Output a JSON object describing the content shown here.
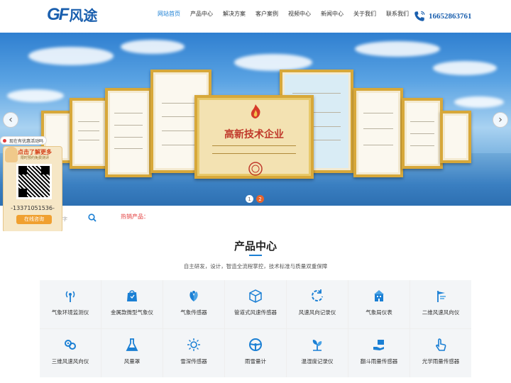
{
  "header": {
    "logo_mark": "GF",
    "logo_text": "风途",
    "phone": "16652863761",
    "nav": [
      "网站首页",
      "产品中心",
      "解决方案",
      "客户案例",
      "视频中心",
      "新闻中心",
      "关于我们",
      "联系我们"
    ],
    "active_nav": "网站首页"
  },
  "banner": {
    "cert_big_title": "高新技术企业",
    "slides": [
      "1",
      "2"
    ],
    "active_slide": "2"
  },
  "search": {
    "hint": "字",
    "hot_label": "热销产品："
  },
  "float": {
    "top_notice": "现在有优惠活动吗",
    "heading": "点击了解更多",
    "subheading": "限时预约免费测评",
    "phone": "-13371051536-",
    "button": "在线咨询"
  },
  "products": {
    "title": "产品中心",
    "subtitle": "自主研发，设计，智造全流程掌控，技术标准与质量双重保障",
    "items": [
      {
        "label": "气象环境监测仪",
        "icon": "antenna-icon"
      },
      {
        "label": "金属款微型气象仪",
        "icon": "shopping-bag-icon"
      },
      {
        "label": "气象传感器",
        "icon": "leaf-icon"
      },
      {
        "label": "管道式风速传感器",
        "icon": "box-icon"
      },
      {
        "label": "风速风向记录仪",
        "icon": "refresh-icon"
      },
      {
        "label": "气象局仪表",
        "icon": "building-icon"
      },
      {
        "label": "二维风速风向仪",
        "icon": "wind-vane-icon"
      },
      {
        "label": "三维风速风向仪",
        "icon": "chain-icon"
      },
      {
        "label": "风量罩",
        "icon": "flask-icon"
      },
      {
        "label": "雪深传感器",
        "icon": "sun-icon"
      },
      {
        "label": "雨雪量计",
        "icon": "steering-wheel-icon"
      },
      {
        "label": "温湿度记录仪",
        "icon": "plant-icon"
      },
      {
        "label": "翻斗雨量传感器",
        "icon": "hand-box-icon"
      },
      {
        "label": "光学雨量传感器",
        "icon": "pointer-hand-icon"
      }
    ]
  },
  "colors": {
    "brand": "#1a5fae",
    "accent": "#1a7fd4",
    "hot": "#e23b3b",
    "slide_active": "#e8632b"
  }
}
